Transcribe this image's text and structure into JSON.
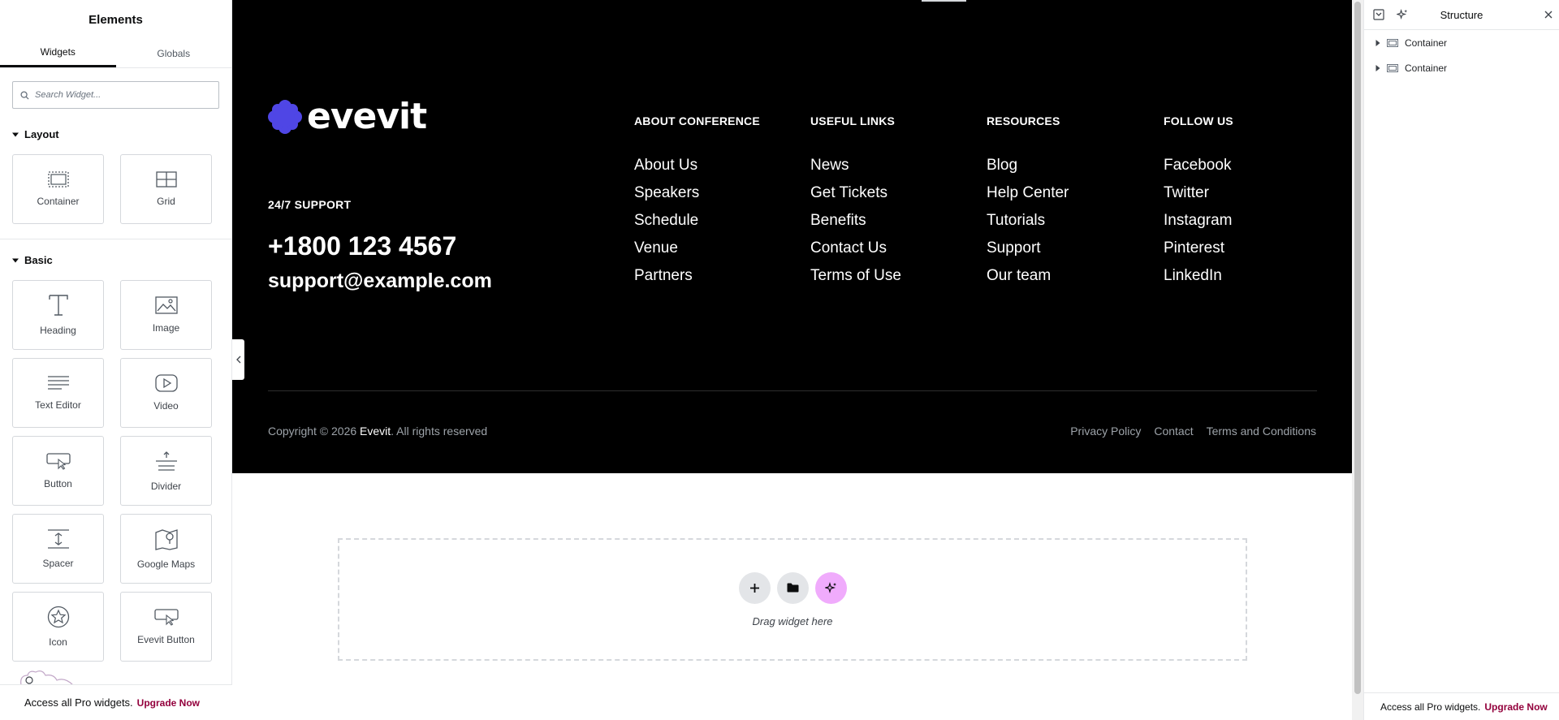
{
  "left_panel": {
    "title": "Elements",
    "tabs": [
      {
        "label": "Widgets"
      },
      {
        "label": "Globals"
      }
    ],
    "search_placeholder": "Search Widget...",
    "sections": [
      {
        "title": "Layout",
        "widgets": [
          {
            "label": "Container",
            "icon": "container-icon"
          },
          {
            "label": "Grid",
            "icon": "grid-icon"
          }
        ]
      },
      {
        "title": "Basic",
        "widgets": [
          {
            "label": "Heading",
            "icon": "heading-icon"
          },
          {
            "label": "Image",
            "icon": "image-icon"
          },
          {
            "label": "Text Editor",
            "icon": "text-editor-icon"
          },
          {
            "label": "Video",
            "icon": "video-icon"
          },
          {
            "label": "Button",
            "icon": "button-icon"
          },
          {
            "label": "Divider",
            "icon": "divider-icon"
          },
          {
            "label": "Spacer",
            "icon": "spacer-icon"
          },
          {
            "label": "Google Maps",
            "icon": "map-icon"
          },
          {
            "label": "Icon",
            "icon": "star-icon"
          },
          {
            "label": "Evevit Button",
            "icon": "button-icon"
          }
        ]
      }
    ],
    "promo_text": "Access all Pro widgets.",
    "promo_link": "Upgrade Now"
  },
  "footer": {
    "logo_text": "evevit",
    "support_label": "24/7 SUPPORT",
    "phone": "+1800 123 4567",
    "email": "support@example.com",
    "columns": [
      {
        "heading": "ABOUT CONFERENCE",
        "links": [
          "About Us",
          "Speakers",
          "Schedule",
          "Venue",
          "Partners"
        ]
      },
      {
        "heading": "USEFUL LINKS",
        "links": [
          "News",
          "Get Tickets",
          "Benefits",
          "Contact Us",
          "Terms of Use"
        ]
      },
      {
        "heading": "RESOURCES",
        "links": [
          "Blog",
          "Help Center",
          "Tutorials",
          "Support",
          "Our team"
        ]
      },
      {
        "heading": "FOLLOW US",
        "links": [
          "Facebook",
          "Twitter",
          "Instagram",
          "Pinterest",
          "LinkedIn"
        ]
      }
    ],
    "copyright_prefix": "Copyright © 2026",
    "copyright_brand": "Evevit",
    "copyright_suffix": ". All rights reserved",
    "legal_links": [
      "Privacy Policy",
      "Contact",
      "Terms and Conditions"
    ]
  },
  "dropzone": {
    "text": "Drag widget here"
  },
  "structure_panel": {
    "title": "Structure",
    "items": [
      {
        "label": "Container"
      },
      {
        "label": "Container"
      }
    ],
    "promo_text": "Access all Pro widgets.",
    "promo_link": "Upgrade Now"
  },
  "colors": {
    "accent": "#93003c",
    "logo": "#4f46e5",
    "ai_button": "#f0abfc",
    "footer_bg": "#000000"
  }
}
